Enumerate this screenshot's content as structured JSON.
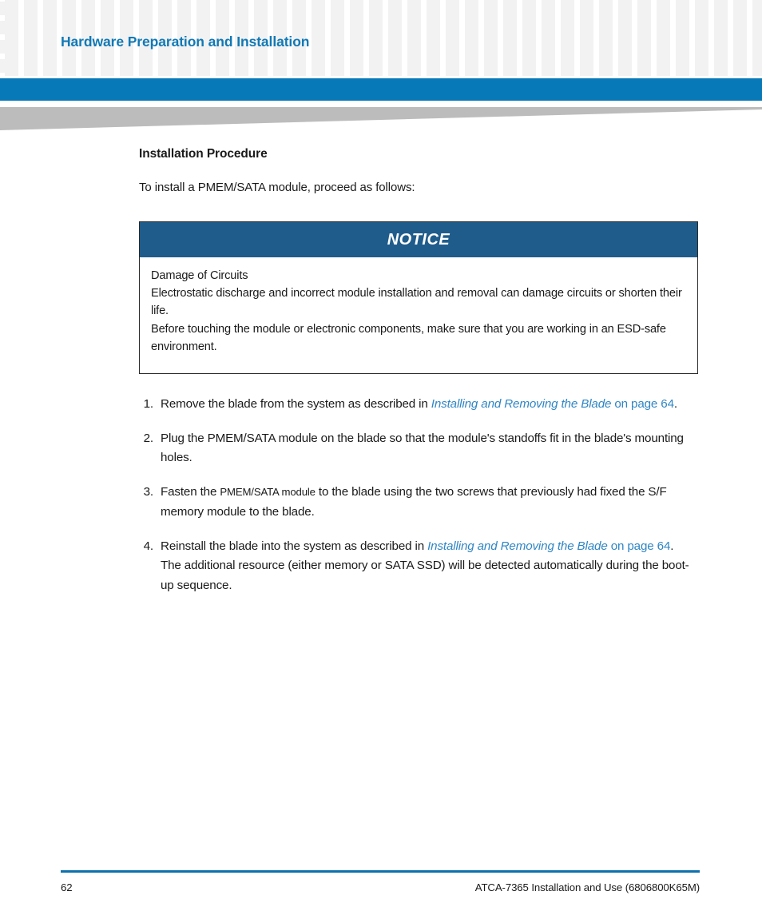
{
  "header": {
    "chapter_title": "Hardware Preparation and Installation",
    "banner_color": "#0879b8",
    "swoosh_color": "#bcbcbc",
    "title_color": "#1179b5"
  },
  "main": {
    "section_heading": "Installation Procedure",
    "intro_text": "To install a PMEM/SATA module, proceed as follows:",
    "notice": {
      "title": "NOTICE",
      "header_color": "#1f5c8b",
      "lines": [
        "Damage of Circuits",
        "Electrostatic discharge and incorrect module installation and removal can damage circuits or shorten their life.",
        "Before touching the module or electronic components, make sure that you are working in an ESD-safe environment."
      ]
    },
    "steps": [
      {
        "number": "1.",
        "lead": "Remove the blade from the system as described in ",
        "link_italic": "Installing and Removing the Blade",
        "link_plain": " on page 64",
        "tail": "."
      },
      {
        "number": "2.",
        "lead": "Plug the PMEM/SATA module on the blade so that the module's standoffs fit in the blade's mounting holes.",
        "link_italic": "",
        "link_plain": "",
        "tail": ""
      },
      {
        "number": "3.",
        "lead": "Fasten the ",
        "small": "PMEM/SATA module",
        "mid": " to the blade using the two screws that previously had fixed the S/F memory module to the blade.",
        "link_italic": "",
        "link_plain": "",
        "tail": ""
      },
      {
        "number": "4.",
        "lead": "Reinstall the blade into the system as described in ",
        "link_italic": "Installing and Removing the Blade",
        "link_plain": " on page 64",
        "tail": ".",
        "extra": "The additional resource (either memory or SATA SSD) will be detected automatically during the boot-up sequence."
      }
    ]
  },
  "footer": {
    "page_number": "62",
    "document_id": "ATCA-7365 Installation and Use (6806800K65M)",
    "rule_color": "#0c70ad"
  }
}
